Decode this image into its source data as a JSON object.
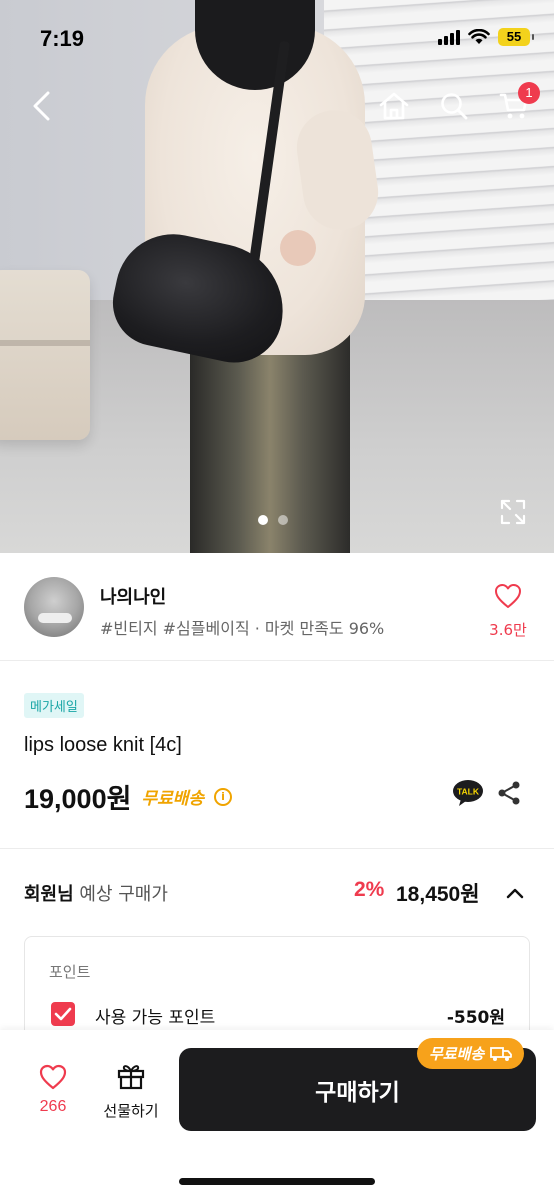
{
  "status_bar": {
    "time": "7:19",
    "battery": "55"
  },
  "header": {
    "cart_count": "1"
  },
  "gallery": {
    "page_dots": 2,
    "active_dot": 1
  },
  "shop": {
    "name": "나의나인",
    "tags": "#빈티지 #심플베이직 · 마켓 만족도 96%",
    "like_count": "3.6만"
  },
  "product": {
    "badge": "메가세일",
    "title": "lips loose knit [4c]",
    "price": "19,000원",
    "shipping": "무료배송"
  },
  "member_price": {
    "label_bold": "회원님",
    "label_rest": " 예상 구매가",
    "discount": "2%",
    "price": "18,450원"
  },
  "points": {
    "title": "포인트",
    "label": "사용 가능 포인트",
    "value": "-550원"
  },
  "bottom_bar": {
    "like_count": "266",
    "gift_label": "선물하기",
    "buy_label": "구매하기",
    "shipping_pill": "무료배송"
  },
  "colors": {
    "accent": "#ef3b4e",
    "shipping": "#f0a400",
    "dark_button": "#1c1c1e",
    "badge_bg": "#e0f6f6",
    "badge_text": "#1aa6a6"
  },
  "icons": [
    "back-icon",
    "home-icon",
    "search-icon",
    "cart-icon",
    "expand-icon",
    "heart-icon",
    "info-icon",
    "kakao-talk-icon",
    "share-icon",
    "chevron-up-icon",
    "checkbox-icon",
    "gift-icon",
    "truck-icon"
  ]
}
